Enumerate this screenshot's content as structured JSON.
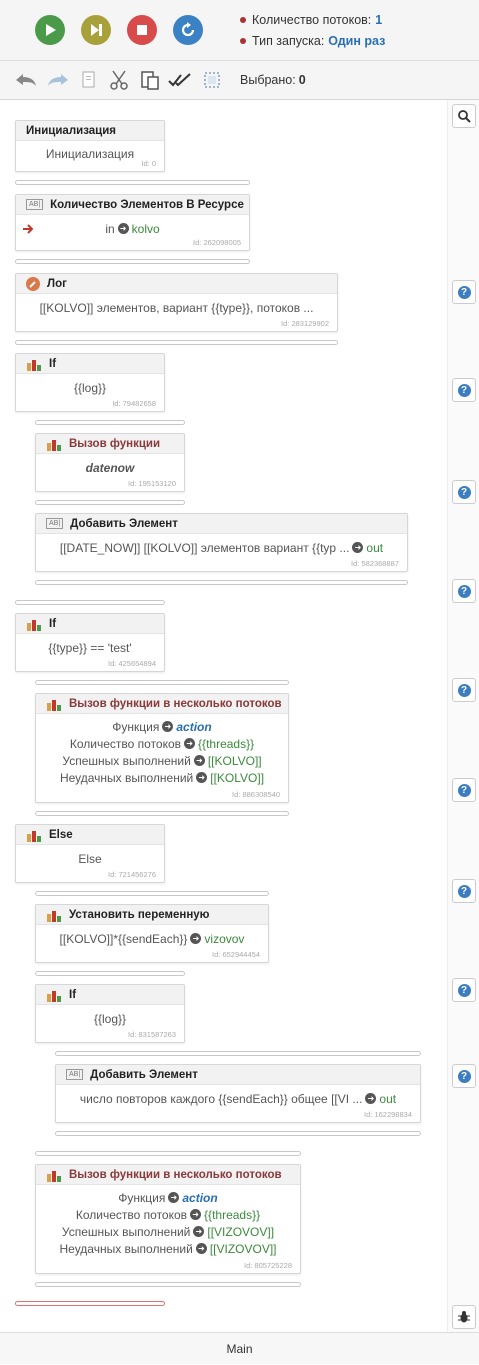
{
  "toolbar": {
    "threads_label": "Количество потоков:",
    "threads_value": "1",
    "launch_label": "Тип запуска:",
    "launch_value": "Один раз",
    "selected_label": "Выбрано:",
    "selected_value": "0"
  },
  "nodes": {
    "init": {
      "title": "Инициализация",
      "body": "Инициализация",
      "id": "Id: 0"
    },
    "count": {
      "title": "Количество Элементов В Ресурсе",
      "in": "in",
      "out": "kolvo",
      "id": "Id: 262098005"
    },
    "log": {
      "title": "Лог",
      "body": "[[KOLVO]] элементов, вариант {{type}}, потоков ...",
      "id": "Id: 283129902"
    },
    "if1": {
      "title": "If",
      "body": "{{log}}",
      "id": "Id: 79482658"
    },
    "call1": {
      "title": "Вызов функции",
      "body": "datenow",
      "id": "Id: 195153120"
    },
    "add1": {
      "title": "Добавить Элемент",
      "body": "[[DATE_NOW]] [[KOLVO]] элементов вариант {{typ ...",
      "out": "out",
      "id": "Id: 582368887"
    },
    "if2": {
      "title": "If",
      "body": "{{type}} == 'test'",
      "id": "Id: 425654894"
    },
    "multi1": {
      "title": "Вызов функции в несколько потоков",
      "l1": "Функция",
      "v1": "action",
      "l2": "Количество потоков",
      "v2": "{{threads}}",
      "l3": "Успешных выполнений",
      "v3": "[[KOLVO]]",
      "l4": "Неудачных выполнений",
      "v4": "[[KOLVO]]",
      "id": "Id: 886308540"
    },
    "else": {
      "title": "Else",
      "body": "Else",
      "id": "Id: 721456276"
    },
    "setvar": {
      "title": "Установить переменную",
      "body": "[[KOLVO]]*{{sendEach}}",
      "out": "vizovov",
      "id": "Id: 652944454"
    },
    "if3": {
      "title": "If",
      "body": "{{log}}",
      "id": "Id: 831587263"
    },
    "add2": {
      "title": "Добавить Элемент",
      "body": "число повторов каждого {{sendEach}} общее [[VI ...",
      "out": "out",
      "id": "Id: 162298834"
    },
    "multi2": {
      "title": "Вызов функции в несколько потоков",
      "l1": "Функция",
      "v1": "action",
      "l2": "Количество потоков",
      "v2": "{{threads}}",
      "l3": "Успешных выполнений",
      "v3": "[[VIZOVOV]]",
      "l4": "Неудачных выполнений",
      "v4": "[[VIZOVOV]]",
      "id": "Id: 805725228"
    }
  },
  "footer": {
    "tab": "Main"
  }
}
